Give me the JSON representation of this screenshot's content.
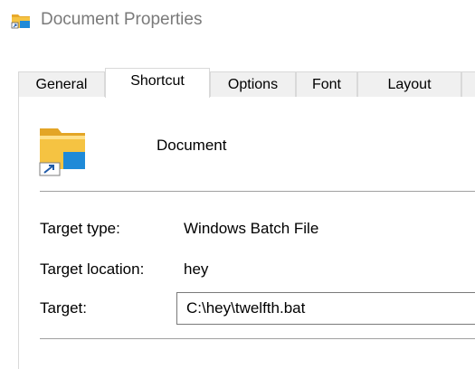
{
  "window": {
    "title": "Document Properties",
    "title_icon": "folder-shortcut-icon"
  },
  "tabs": [
    {
      "label": "General",
      "active": false
    },
    {
      "label": "Shortcut",
      "active": true
    },
    {
      "label": "Options",
      "active": false
    },
    {
      "label": "Font",
      "active": false
    },
    {
      "label": "Layout",
      "active": false
    }
  ],
  "shortcut": {
    "icon": "folder-shortcut-icon",
    "name": "Document",
    "target_type_label": "Target type:",
    "target_type_value": "Windows Batch File",
    "target_location_label": "Target location:",
    "target_location_value": "hey",
    "target_label": "Target:",
    "target_value": "C:\\hey\\twelfth.bat"
  },
  "colors": {
    "folder_yellow": "#f5c342",
    "folder_light": "#ffe28a",
    "accent_blue": "#1f8ad8",
    "title_gray": "#7a7a7a",
    "border_gray": "#d9d9d9"
  }
}
